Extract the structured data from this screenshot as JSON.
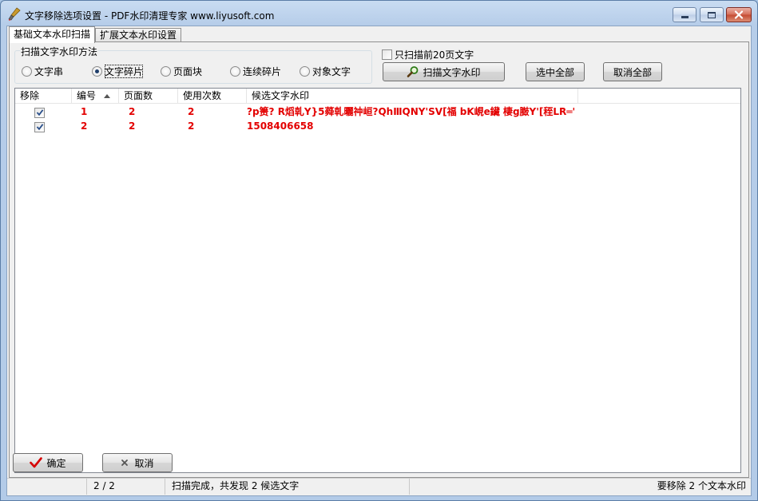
{
  "window": {
    "title": "文字移除选项设置 - PDF水印清理专家 www.liyusoft.com"
  },
  "tabs": [
    {
      "label": "基础文本水印扫描",
      "active": true
    },
    {
      "label": "扩展文本水印设置",
      "active": false
    }
  ],
  "scan_method": {
    "title": "扫描文字水印方法",
    "options": [
      {
        "label": "文字串",
        "selected": false
      },
      {
        "label": "文字碎片",
        "selected": true
      },
      {
        "label": "页面块",
        "selected": false
      },
      {
        "label": "连续碎片",
        "selected": false
      },
      {
        "label": "对象文字",
        "selected": false
      }
    ]
  },
  "scan_first20": {
    "label": "只扫描前20页文字",
    "checked": false
  },
  "buttons": {
    "scan": "扫描文字水印",
    "select_all": "选中全部",
    "deselect_all": "取消全部",
    "ok": "确定",
    "cancel": "取消"
  },
  "table": {
    "columns": [
      "移除",
      "编号",
      "页面数",
      "使用次数",
      "候选文字水印"
    ],
    "sort_column": "编号",
    "rows": [
      {
        "checked": true,
        "id": "1",
        "pages": "2",
        "uses": "2",
        "text": "?p箦? R熖乹Y}5蕣乹曬祌峘?QhⅢQNY'SV[福 bK峴e鑶 棲g臌Y'[秷LR═'"
      },
      {
        "checked": true,
        "id": "2",
        "pages": "2",
        "uses": "2",
        "text": "1508406658"
      }
    ]
  },
  "status": {
    "page": "2 / 2",
    "message": "扫描完成，共发现 2 候选文字",
    "summary": "要移除 2 个文本水印"
  },
  "colors": {
    "row_text": "#e30000",
    "check_mark": "#2a4f8a",
    "ok_icon": "#d60000"
  }
}
